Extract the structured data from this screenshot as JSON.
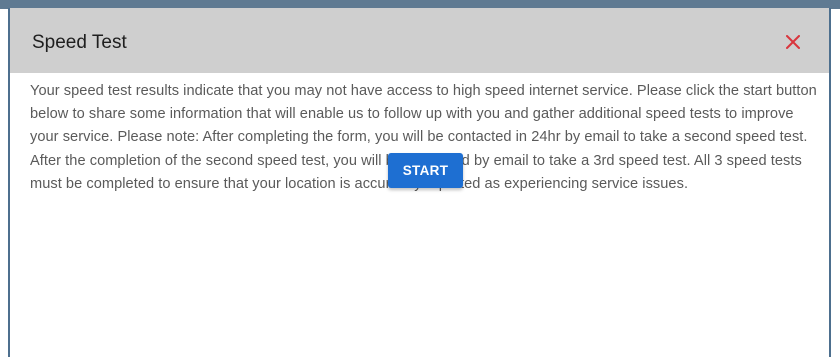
{
  "modal": {
    "title": "Speed Test",
    "close_icon": "close-icon",
    "close_color": "#d9363e",
    "header_background": "#cfcfcf",
    "message": "Your speed test results indicate that you may not have access to high speed internet service. Please click the start button below to share some information that will enable us to follow up with you and gather additional speed tests to improve your service. Please note: After completing the form, you will be contacted in 24hr by email to take a second speed test. After the completion of the second speed test, you will be contacted by email to take a 3rd speed test. All 3 speed tests must be completed to ensure that your location is accurately reported as experiencing service issues.",
    "start_label": "START",
    "accent_color": "#1e6fd2"
  }
}
